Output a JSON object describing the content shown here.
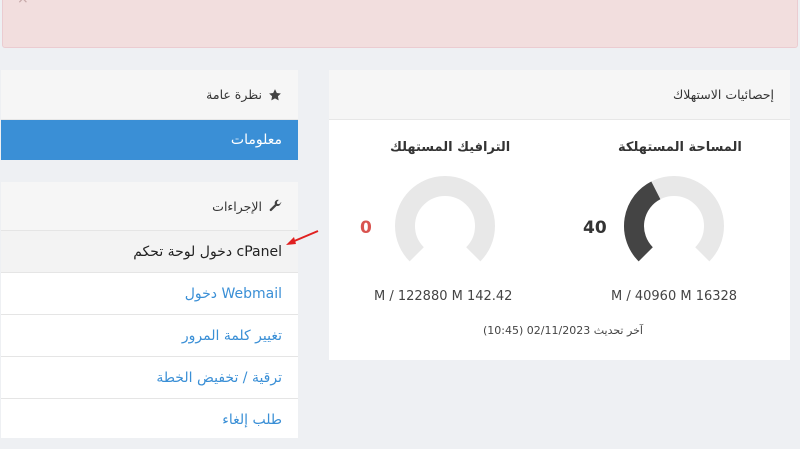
{
  "alert": {
    "close_glyph": "×"
  },
  "overview": {
    "title": "نظرة عامة",
    "info_label": "معلومات"
  },
  "actions": {
    "title": "الإجراءات",
    "items": [
      {
        "label": "دخول لوحة تحكم cPanel",
        "active": true
      },
      {
        "label": "دخول Webmail",
        "active": false
      },
      {
        "label": "تغيير كلمة المرور",
        "active": false
      },
      {
        "label": "ترقية / تخفيض الخطة",
        "active": false
      },
      {
        "label": "طلب إلغاء",
        "active": false
      }
    ]
  },
  "stats": {
    "title": "إحصائيات الاستهلاك",
    "disk": {
      "title": "المساحة المستهلكة",
      "percent": 40,
      "value": "40",
      "detail": "M / 40960 M 16328"
    },
    "bandwidth": {
      "title": "الترافيك المستهلك",
      "percent": 0,
      "value": "0",
      "detail": "M / 122880 M 142.42"
    },
    "last_updated": "آخر تحديث 02/11/2023 (10:45)"
  },
  "colors": {
    "primary": "#3a8fd6",
    "gauge_track": "#e8e8e8",
    "gauge_fill": "#444444",
    "zero_value": "#d9534f"
  },
  "icons": {
    "overview": "star-icon",
    "actions": "wrench-icon",
    "close": "close-icon"
  }
}
